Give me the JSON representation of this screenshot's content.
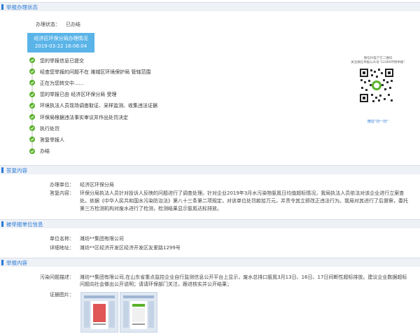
{
  "status_section": {
    "title": "举报办理状态",
    "status_label": "办理状态：",
    "status_value": "已办结",
    "banner_title": "经济区环保分局办理情况",
    "banner_time": "2019-03-22 16:06:04",
    "timeline": [
      "您的举报信息已提交",
      "经查您举报的问题不在 潍城区环境保护局 管辖范围",
      "正在为您转交中......",
      "您的举报已由 经济区环保分局 受理",
      "环境执法人员现场调查取证、采样监测、收集违法证据",
      "环保局根据违法事实审议并作出处罚决定",
      "执行处罚",
      "答复举报人",
      "办结"
    ],
    "qr": {
      "caption_top": "微信扫描下方二维码",
      "caption_top2": "关注微信举报公众号“12369环保举报”",
      "caption_bottom": "微信“扫一扫”"
    }
  },
  "reply_section": {
    "title": "答复内容",
    "unit_label": "办理单位：",
    "unit_value": "经济区环保分局",
    "content_label": "答复内容：",
    "content_value": "环保分局执法人员针对投诉人反映的问题进行了调查处理。针对企业2019年3月水污染物氨氮日均值超标情况，我局执法人员依法对该企业进行立案查处。依据《中华人民共和国水污染防治法》第八十三条第二项规定，对该单位处罚款拾万元，并责令其立即改正违法行为。我局对其进行了后督察，委托第三方检测机构对废水进行了检测，检测结果显示氨氮达标排放。"
  },
  "reported_unit_section": {
    "title": "被举报单位信息",
    "name_label": "单位名称：",
    "name_value": "潍坊**集团有限公司",
    "address_label": "详细地址：",
    "address_value": "潍坊**区经济开发区经济开发区友爱路1299号"
  },
  "report_section": {
    "title": "举报内容",
    "desc_label": "污染问题描述：",
    "desc_value": "潍坊**集团有限公司,在山东省重点监控企业自行监测信息公开平台上显示，废水总排口氨氮3月13日、16日、17日间断性超标排放。建议企业数据超标问题向社会做出公开说明；请请环保部门关注，跟进核实并公开结果；",
    "evidence_label": "证据图片："
  }
}
